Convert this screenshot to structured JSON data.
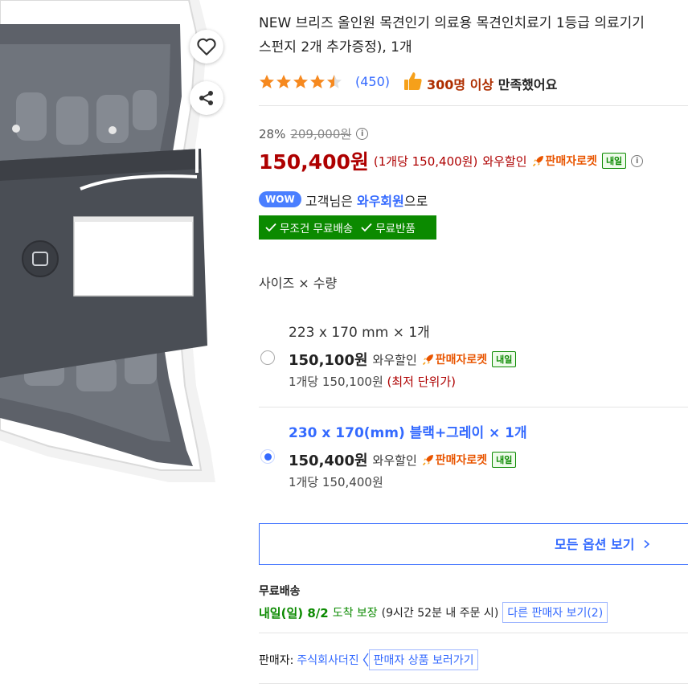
{
  "product": {
    "title_line1": "NEW 브리즈 올인원 목견인기 의료용 목견인치료기 1등급 의료기기",
    "title_line2": "스펀지 2개 추가증정), 1개",
    "rating": 4.5,
    "rating_count": "(450)",
    "satisfy_highlight": "300명 이상",
    "satisfy_rest": "만족했어요",
    "image_alt": "cervical traction device product photo"
  },
  "actions": {
    "wishlist_icon": "heart-icon",
    "share_icon": "share-icon"
  },
  "price": {
    "discount_rate": "28%",
    "original_price": "209,000원",
    "sale_price": "150,400원",
    "unit_price": "(1개당 150,400원)",
    "wow_discount": "와우할인",
    "rocket_label": "판매자로켓",
    "tomorrow_badge": "내일"
  },
  "membership": {
    "badge": "WOW",
    "text_pre": "고객님은 ",
    "text_highlight": "와우회원",
    "text_post": "으로",
    "free_shipping": "무조건 무료배송",
    "free_return": "무료반품"
  },
  "options": {
    "header": "사이즈 × 수량",
    "items": [
      {
        "name": "223 x 170 mm × 1개",
        "price": "150,100원",
        "wow": "와우할인",
        "rocket": "판매자로켓",
        "badge": "내일",
        "unit_price": "1개당 150,100원",
        "note": "(최저 단위가)",
        "selected": false
      },
      {
        "name": "230 x 170(mm) 블랙+그레이 × 1개",
        "price": "150,400원",
        "wow": "와우할인",
        "rocket": "판매자로켓",
        "badge": "내일",
        "unit_price": "1개당 150,400원",
        "selected": true
      }
    ],
    "view_all": "모든 옵션 보기"
  },
  "shipping": {
    "title": "무료배송",
    "date": "내일(일) 8/2",
    "arrive": "도착 보장",
    "note": "(9시간 52분 내 주문 시)",
    "other_sellers": "다른 판매자 보기(2)"
  },
  "seller": {
    "label": "판매자:",
    "name": "주식회사더진",
    "goto": "판매자 상품 보러가기"
  },
  "colors": {
    "accent_blue": "#346aff",
    "price_red": "#ae0000",
    "rocket_orange": "#e95500",
    "green": "#0b8a00"
  }
}
